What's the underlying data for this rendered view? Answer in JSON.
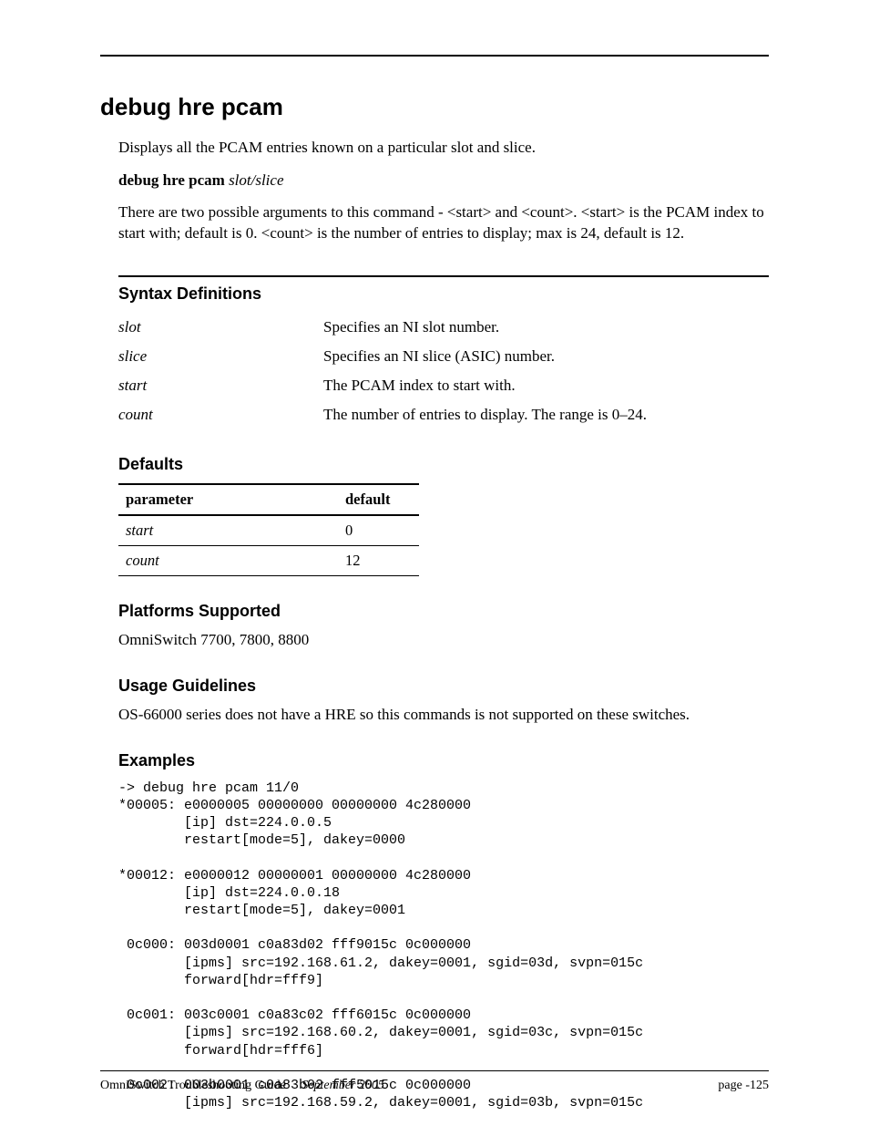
{
  "title": "debug hre pcam",
  "intro": "Displays all the PCAM entries known on a particular slot and slice.",
  "syntax": {
    "cmd_bold": "debug hre pcam ",
    "args_italic": "slot/slice"
  },
  "arg_desc": "There are two possible arguments to this command - <start> and <count>. <start> is the PCAM index to start with; default is 0. <count> is the number of entries to display; max is 24, default is 12.",
  "syntax_def": {
    "heading": "Syntax Definitions",
    "rows": [
      {
        "param": "slot",
        "desc": "Specifies an NI slot number."
      },
      {
        "param": "slice",
        "desc": "Specifies an NI slice (ASIC) number."
      },
      {
        "param": "start",
        "desc": "The PCAM index to start with."
      },
      {
        "param": "count",
        "desc": "The number of entries to display. The range is 0–24."
      }
    ]
  },
  "defaults": {
    "heading": "Defaults",
    "header": {
      "p": "parameter",
      "d": "default"
    },
    "rows": [
      {
        "p": "start",
        "d": "0"
      },
      {
        "p": "count",
        "d": "12"
      }
    ]
  },
  "platforms": {
    "heading": "Platforms Supported",
    "text": "OmniSwitch 7700, 7800, 8800"
  },
  "usage": {
    "heading": "Usage Guidelines",
    "text": "OS-66000 series does not have a HRE so this commands is not supported on these switches."
  },
  "examples": {
    "heading": "Examples",
    "text": "-> debug hre pcam 11/0\n*00005: e0000005 00000000 00000000 4c280000\n        [ip] dst=224.0.0.5\n        restart[mode=5], dakey=0000\n\n*00012: e0000012 00000001 00000000 4c280000\n        [ip] dst=224.0.0.18\n        restart[mode=5], dakey=0001\n\n 0c000: 003d0001 c0a83d02 fff9015c 0c000000\n        [ipms] src=192.168.61.2, dakey=0001, sgid=03d, svpn=015c\n        forward[hdr=fff9]\n\n 0c001: 003c0001 c0a83c02 fff6015c 0c000000\n        [ipms] src=192.168.60.2, dakey=0001, sgid=03c, svpn=015c\n        forward[hdr=fff6]\n\n 0c002: 003b0001 c0a83b02 fff5015c 0c000000\n        [ipms] src=192.168.59.2, dakey=0001, sgid=03b, svpn=015c"
  },
  "footer": {
    "doc": "OmniSwitch Troubleshooting Guide",
    "date": "September 2005",
    "page": "page -125"
  }
}
